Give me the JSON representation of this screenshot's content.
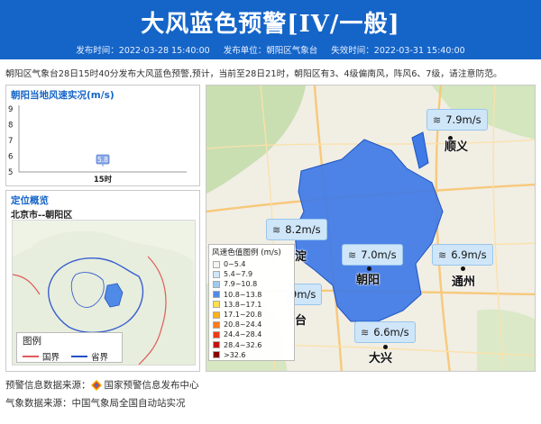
{
  "header": {
    "title": "大风蓝色预警[IV/一般]",
    "publish_time": "发布时间：2022-03-28 15:40:00",
    "publisher": "发布单位：朝阳区气象台",
    "expire_time": "失效时间：2022-03-31 15:40:00"
  },
  "description": "朝阳区气象台28日15时40分发布大风蓝色预警,预计，当前至28日21时，朝阳区有3、4级偏南风，阵风6、7级，请注意防范。",
  "wind_panel": {
    "title": "朝阳当地风速实况(m/s)",
    "chart_data": {
      "type": "scatter",
      "title": "朝阳当地风速实况(m/s)",
      "categories": [
        "15时"
      ],
      "values": [
        5.8
      ],
      "data_labels": [
        "5.8"
      ],
      "y_ticks": [
        "5",
        "6",
        "7",
        "8",
        "9"
      ],
      "ylim": [
        5,
        9
      ],
      "grid": false
    }
  },
  "location_panel": {
    "title": "定位概览",
    "location": "北京市--朝阳区",
    "legend": {
      "title": "图例",
      "items": [
        {
          "label": "国界",
          "color": "#e05a5a"
        },
        {
          "label": "省界",
          "color": "#2050c8"
        }
      ]
    }
  },
  "map": {
    "wind_labels": [
      {
        "value": "7.9m/s"
      },
      {
        "value": "8.2m/s"
      },
      {
        "value": "7.0m/s"
      },
      {
        "value": "6.9m/s"
      },
      {
        "value": "9m/s"
      },
      {
        "value": "6.6m/s"
      }
    ],
    "cities": [
      {
        "name": "顺义"
      },
      {
        "name": "淀"
      },
      {
        "name": "朝阳"
      },
      {
        "name": "通州"
      },
      {
        "name": "台"
      },
      {
        "name": "大兴"
      }
    ],
    "legend": {
      "title": "风速色值图例 (m/s)",
      "items": [
        {
          "label": "0~5.4",
          "color": "#f4f4f4"
        },
        {
          "label": "5.4~7.9",
          "color": "#cfe6f9"
        },
        {
          "label": "7.9~10.8",
          "color": "#9dcaf0"
        },
        {
          "label": "10.8~13.8",
          "color": "#4f8be6"
        },
        {
          "label": "13.8~17.1",
          "color": "#ffe14a"
        },
        {
          "label": "17.1~20.8",
          "color": "#ffb020"
        },
        {
          "label": "20.8~24.4",
          "color": "#ff7a1a"
        },
        {
          "label": "24.4~28.4",
          "color": "#ee3a16"
        },
        {
          "label": "28.4~32.6",
          "color": "#c41010"
        },
        {
          "label": ">32.6",
          "color": "#8a0000"
        }
      ]
    },
    "highlight_color": "#3f7ae6"
  },
  "sources": {
    "warning_label": "预警信息数据来源：",
    "warning_value": "国家预警信息发布中心",
    "weather": "气象数据来源：中国气象局全国自动站实况"
  }
}
